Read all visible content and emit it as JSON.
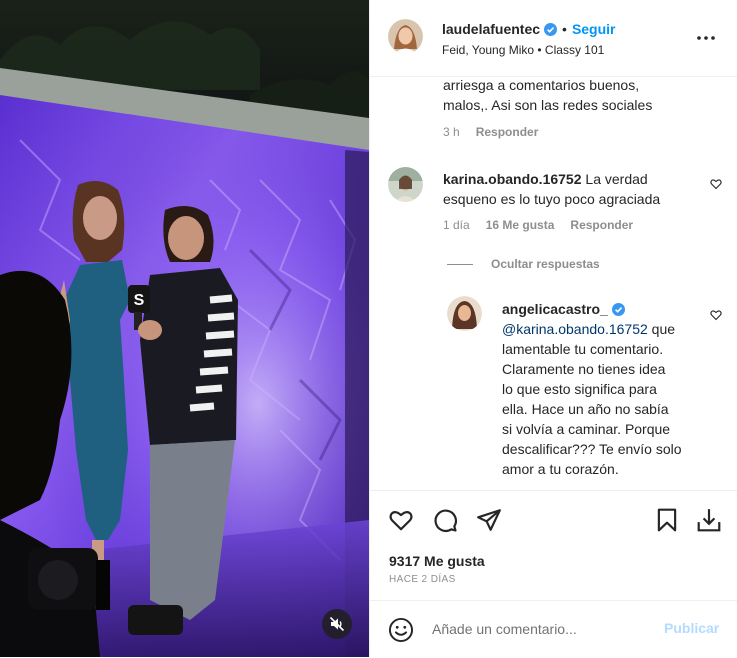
{
  "header": {
    "username": "laudelafuentec",
    "follow_label": "Seguir",
    "audio": "Feid, Young Miko • Classy 101",
    "separator": "•"
  },
  "comments": [
    {
      "text_lines": [
        "arriesga a comentarios buenos,",
        "malos,. Asi son las redes sociales"
      ],
      "time": "3 h",
      "reply_label": "Responder"
    },
    {
      "username": "karina.obando.16752",
      "text_lines": [
        " La verdad",
        "esqueno es lo tuyo poco agraciada"
      ],
      "time": "1 día",
      "likes": "16 Me gusta",
      "reply_label": "Responder"
    }
  ],
  "hide_replies_label": "Ocultar respuestas",
  "reply": {
    "username": "angelicacastro_",
    "mention": "@karina.obando.16752",
    "text_lines": [
      " que",
      "lamentable tu comentario.",
      "Claramente no tienes idea",
      "lo que esto significa para",
      "ella. Hace un año no sabía",
      "si volvía a caminar. Porque",
      "descalificar??? Te envío solo",
      "amor a tu corazón."
    ]
  },
  "actions": {
    "icons": [
      "heart-icon",
      "comment-icon",
      "share-icon",
      "bookmark-icon",
      "download-icon"
    ]
  },
  "likes_count": "9317 Me gusta",
  "posted": "HACE 2 DÍAS",
  "add_comment": {
    "placeholder": "Añade un comentario...",
    "publish_label": "Publicar"
  },
  "colors": {
    "link_blue": "#0095f6",
    "verified_blue": "#3897f0",
    "muted_text": "#8e8e8e",
    "publish_disabled": "#b3dbff",
    "stage_purple": "#7d47e8"
  }
}
